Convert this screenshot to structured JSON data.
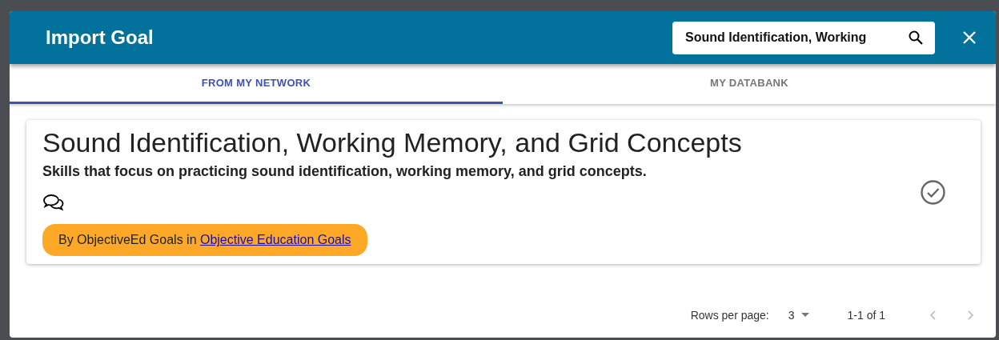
{
  "dialog": {
    "title": "Import Goal",
    "search": {
      "value": "Sound Identification, Working"
    }
  },
  "tabs": [
    {
      "label": "FROM MY NETWORK",
      "selected": true
    },
    {
      "label": "MY DATABANK",
      "selected": false
    }
  ],
  "goals": [
    {
      "title": "Sound Identification, Working Memory, and Grid Concepts",
      "description": "Skills that focus on practicing sound identification, working memory, and grid concepts.",
      "selected": false,
      "source": {
        "text": "By ObjectiveEd Goals in ",
        "link": "Objective Education Goals"
      }
    }
  ],
  "pagination": {
    "rows_label": "Rows per page:",
    "rows_value": "3",
    "range": "1-1 of 1",
    "prev_disabled": true,
    "next_disabled": true
  }
}
